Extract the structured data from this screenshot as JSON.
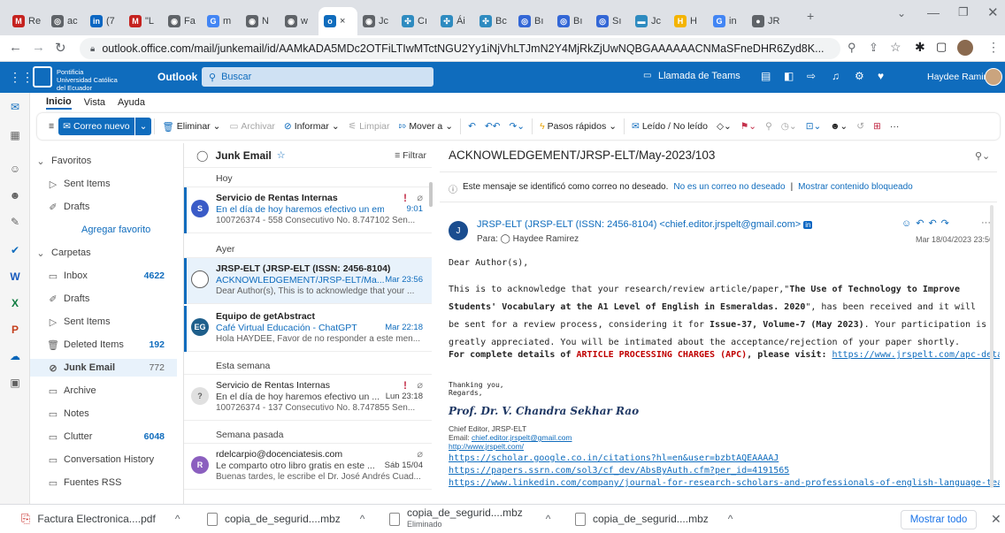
{
  "browser": {
    "tabs": [
      {
        "icon": "M",
        "color": "#c5221f",
        "label": "Re"
      },
      {
        "icon": "◎",
        "color": "#5f6368",
        "label": "ac"
      },
      {
        "icon": "in",
        "color": "#0a66c2",
        "label": "(7"
      },
      {
        "icon": "M",
        "color": "#c5221f",
        "label": "\"L"
      },
      {
        "icon": "◉",
        "color": "#5f6368",
        "label": "Fa"
      },
      {
        "icon": "G",
        "color": "#4285f4",
        "label": "m"
      },
      {
        "icon": "◉",
        "color": "#5f6368",
        "label": "N"
      },
      {
        "icon": "◉",
        "color": "#5f6368",
        "label": "w"
      },
      {
        "icon": "o",
        "color": "#0f6cbd",
        "label": "×"
      },
      {
        "icon": "◉",
        "color": "#5f6368",
        "label": "Jc"
      },
      {
        "icon": "✣",
        "color": "#2e8bc0",
        "label": "Cı"
      },
      {
        "icon": "✣",
        "color": "#2e8bc0",
        "label": "Ái"
      },
      {
        "icon": "✣",
        "color": "#2e8bc0",
        "label": "Bc"
      },
      {
        "icon": "◎",
        "color": "#3367d6",
        "label": "Bı"
      },
      {
        "icon": "◎",
        "color": "#3367d6",
        "label": "Bı"
      },
      {
        "icon": "◎",
        "color": "#3367d6",
        "label": "Sı"
      },
      {
        "icon": "▬",
        "color": "#2e8bc0",
        "label": "Jc"
      },
      {
        "icon": "H",
        "color": "#f4b400",
        "label": "H"
      },
      {
        "icon": "G",
        "color": "#4285f4",
        "label": "in"
      },
      {
        "icon": "●",
        "color": "#5f6368",
        "label": "JR"
      }
    ],
    "new_tab": "+",
    "url": "outlook.office.com/mail/junkemail/id/AAMkADA5MDc2OTFiLTIwMTctNGU2Yy1iNjVhLTJmN2Y4MjRkZjUwNQBGAAAAAACNMaSFneDHR6Zyd8K..."
  },
  "header": {
    "org": "Pontificia Universidad Católica del Ecuador",
    "app": "Outlook",
    "search_placeholder": "Buscar",
    "teams": "Llamada de Teams",
    "user": "Haydee Ramirez"
  },
  "ribbon": {
    "tabs": [
      "Inicio",
      "Vista",
      "Ayuda"
    ],
    "new_mail": "Correo nuevo",
    "delete": "Eliminar",
    "archive": "Archivar",
    "report": "Informar",
    "clean": "Limpiar",
    "move": "Mover a",
    "quick": "Pasos rápidos",
    "read": "Leído / No leído"
  },
  "folders": {
    "favorites_header": "Favoritos",
    "favorites": [
      {
        "label": "Sent Items"
      },
      {
        "label": "Drafts"
      }
    ],
    "add_favorite": "Agregar favorito",
    "folders_header": "Carpetas",
    "items": [
      {
        "label": "Inbox",
        "count": "4622"
      },
      {
        "label": "Drafts",
        "count": ""
      },
      {
        "label": "Sent Items",
        "count": ""
      },
      {
        "label": "Deleted Items",
        "count": "192"
      },
      {
        "label": "Junk Email",
        "count": "772"
      },
      {
        "label": "Archive",
        "count": ""
      },
      {
        "label": "Notes",
        "count": ""
      },
      {
        "label": "Clutter",
        "count": "6048"
      },
      {
        "label": "Conversation History",
        "count": ""
      },
      {
        "label": "Fuentes RSS",
        "count": ""
      }
    ]
  },
  "list": {
    "title": "Junk Email",
    "filter": "Filtrar",
    "groups": [
      "Hoy",
      "Ayer",
      "Esta semana",
      "Semana pasada"
    ],
    "messages": [
      {
        "avatar": "S",
        "color": "#3a5bc7",
        "sender": "Servicio de Rentas Internas",
        "subject": "En el día de hoy haremos efectivo un em...",
        "time": "9:01",
        "preview": "100726374 - 558 Consecutivo No. 8.747102 Sen..."
      },
      {
        "avatar": "",
        "color": "#ffffff",
        "sender": "JRSP-ELT (JRSP-ELT (ISSN: 2456-8104)",
        "subject": "ACKNOWLEDGEMENT/JRSP-ELT/Ma...",
        "time": "Mar 23:56",
        "preview": "Dear Author(s), This is to acknowledge that your ..."
      },
      {
        "avatar": "EG",
        "color": "#1f5f8b",
        "sender": "Equipo de getAbstract",
        "subject": "Café Virtual Educación - ChatGPT",
        "time": "Mar 22:18",
        "preview": "Hola HAYDEE, Favor de no responder a este men..."
      },
      {
        "avatar": "?",
        "color": "#e0e0e0",
        "sender": "Servicio de Rentas Internas",
        "subject": "En el día de hoy haremos efectivo un ...",
        "time": "Lun 23:18",
        "preview": "100726374 - 137 Consecutivo No. 8.747855 Sen..."
      },
      {
        "avatar": "R",
        "color": "#8b5fbf",
        "sender": "rdelcarpio@docenciatesis.com",
        "subject": "Le comparto otro libro gratis en este ...",
        "time": "Sáb 15/04",
        "preview": "Buenas tardes, le escribe el Dr. José Andrés Cuad..."
      }
    ]
  },
  "reading": {
    "subject": "ACKNOWLEDGEMENT/JRSP-ELT/May-2023/103",
    "junk_notice": "Este mensaje se identificó como correo no deseado.",
    "not_junk": "No es un correo no deseado",
    "show_blocked": "Mostrar contenido bloqueado",
    "sep": "|",
    "avatar": "J",
    "from": "JRSP-ELT (JRSP-ELT (ISSN: 2456-8104) <chief.editor.jrspelt@gmail.com>",
    "to_label": "Para:",
    "to": "Haydee Ramirez",
    "date": "Mar 18/04/2023 23:56",
    "greeting": "Dear Author(s),",
    "p1a": "This is to acknowledge that your research/review article/paper,\"",
    "p1b": "The Use of Technology to Improve Students' Vocabulary at the A1 Level of English in Esmeraldas. 2020",
    "p1c": "\", has been received and it will be sent for a review process, considering it for",
    "p1d": "Issue-37, Volume-7 (May 2023)",
    "p1e": ". Your participation is greatly appreciated. You will be intimated about the acceptance/rejection of your paper shortly.",
    "p2a": "For complete details of",
    "p2b": "ARTICLE PROCESSING CHARGES (APC)",
    "p2c": ", please visit:",
    "p2link": "https://www.jrspelt.com/apc-details/",
    "thanks": "Thanking you,",
    "regards": "Regards,",
    "signature": "Prof. Dr. V. Chandra Sekhar Rao",
    "role": "Chief Editor, JRSP-ELT",
    "email_label": "Email:",
    "email": "chief.editor.jrspelt@gmail.com",
    "site": "http://www.jrspelt.com/",
    "links": [
      "https://scholar.google.co.in/citations?hl=en&user=bzbtAQEAAAAJ",
      "https://papers.ssrn.com/sol3/cf_dev/AbsByAuth.cfm?per_id=4191565",
      "https://www.linkedin.com/company/journal-for-research-scholars-and-professionals-of-english-language-teaching/?"
    ]
  },
  "downloads": {
    "items": [
      {
        "name": "Factura Electronica....pdf",
        "sub": ""
      },
      {
        "name": "copia_de_segurid....mbz",
        "sub": ""
      },
      {
        "name": "copia_de_segurid....mbz",
        "sub": "Eliminado"
      },
      {
        "name": "copia_de_segurid....mbz",
        "sub": ""
      }
    ],
    "show_all": "Mostrar todo"
  }
}
